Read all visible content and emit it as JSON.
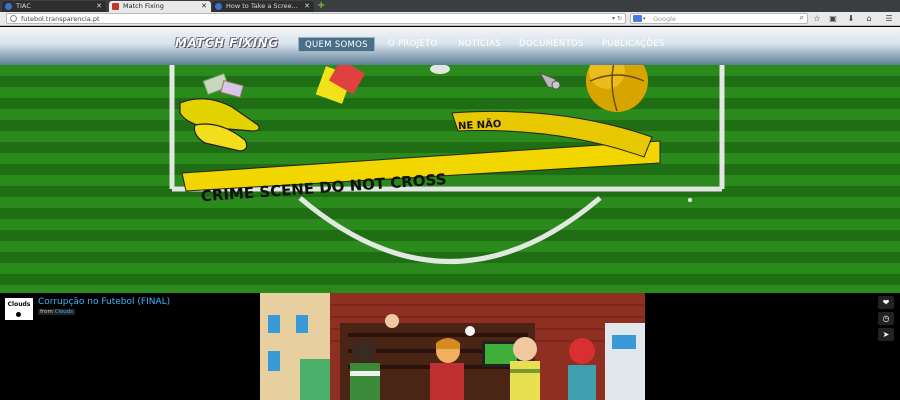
{
  "browser": {
    "tabs": [
      {
        "label": "TIAC",
        "active": false,
        "favicon_color": "#3a73c8"
      },
      {
        "label": "Match Fixing",
        "active": true,
        "favicon_color": "#c0392b"
      },
      {
        "label": "How to Take a Scree...",
        "active": false,
        "favicon_color": "#3a73c8"
      }
    ],
    "url": "futebol.transparencia.pt",
    "search_placeholder": "Google"
  },
  "site": {
    "logo_text": "MATCH FIXING",
    "nav": [
      {
        "label": "QUEM SOMOS",
        "active": true
      },
      {
        "label": "O PROJETO",
        "active": false
      },
      {
        "label": "NOTÍCIAS",
        "active": false
      },
      {
        "label": "DOCUMENTOS",
        "active": false
      },
      {
        "label": "PUBLICAÇÕES",
        "active": false
      }
    ],
    "hero": {
      "tape_text": "CRIME SCENE DO NOT CROSS",
      "tape_text_2": "NE   NÃO",
      "tape_color": "#f2d600",
      "field_color": "#2a8a1c"
    }
  },
  "video": {
    "channel_logo_text": "Clouds",
    "title": "Corrupção no Futebol (FINAL)",
    "from_label": "from",
    "channel": "Clouds",
    "side_icons": [
      "heart-icon",
      "clock-icon",
      "send-icon"
    ]
  },
  "colors": {
    "link_blue": "#3db3ff",
    "header_gradient_bottom": "#5c7e96"
  }
}
